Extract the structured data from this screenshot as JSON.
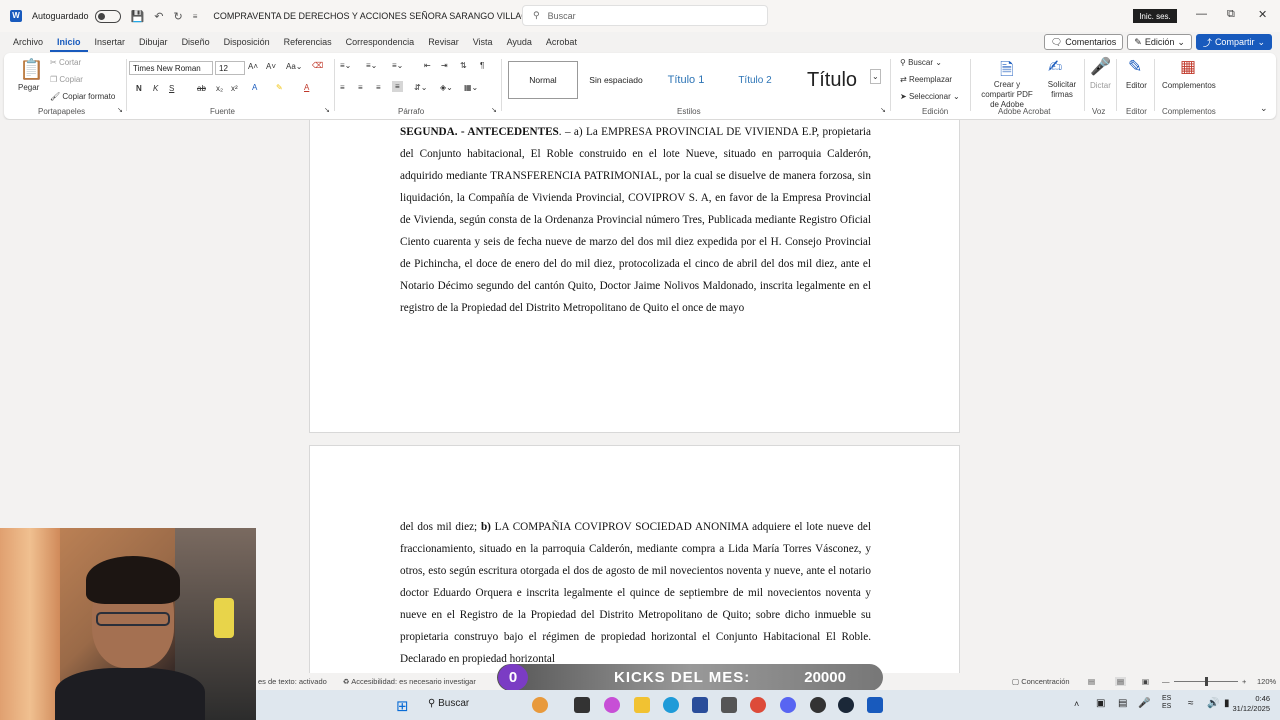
{
  "titlebar": {
    "autosave_label": "Autoguardado",
    "doc_title": "COMPRAVENTA DE DERECHOS Y ACCIONES SEÑORA SARANGO VILLACIS",
    "search_placeholder": "Buscar",
    "signin_label": "Inic. ses."
  },
  "tabs": [
    "Archivo",
    "Inicio",
    "Insertar",
    "Dibujar",
    "Diseño",
    "Disposición",
    "Referencias",
    "Correspondencia",
    "Revisar",
    "Vista",
    "Ayuda",
    "Acrobat"
  ],
  "tab_actions": {
    "comments": "Comentarios",
    "editing": "Edición",
    "share": "Compartir"
  },
  "ribbon": {
    "clipboard": {
      "paste": "Pegar",
      "cut": "Cortar",
      "copy": "Copiar",
      "format_painter": "Copiar formato",
      "label": "Portapapeles"
    },
    "font": {
      "name": "Times New Roman",
      "size": "12",
      "label": "Fuente"
    },
    "paragraph": {
      "label": "Párrafo"
    },
    "styles": {
      "items": [
        "Normal",
        "Sin espaciado",
        "Título 1",
        "Título 2",
        "Título"
      ],
      "label": "Estilos"
    },
    "editing": {
      "find": "Buscar",
      "replace": "Reemplazar",
      "select": "Seleccionar",
      "label": "Edición"
    },
    "adobe": {
      "create_pdf": "Crear y compartir PDF de Adobe",
      "request_sign": "Solicitar firmas",
      "label": "Adobe Acrobat"
    },
    "voice": {
      "dictate": "Dictar",
      "label": "Voz"
    },
    "editor": {
      "name": "Editor",
      "label": "Editor"
    },
    "addins": {
      "name": "Complementos",
      "label": "Complementos"
    }
  },
  "document": {
    "page1": {
      "heading": "SEGUNDA. - ANTECEDENTES",
      "paragraph": ". – a) La EMPRESA PROVINCIAL DE VIVIENDA E.P, propietaria del Conjunto habitacional, El Roble construido en el lote Nueve, situado en parroquia Calderón, adquirido mediante TRANSFERENCIA PATRIMONIAL, por la cual se disuelve de manera forzosa, sin liquidación, la Compañía de Vivienda Provincial, COVIPROV S. A, en favor de la Empresa Provincial de Vivienda, según consta de la Ordenanza Provincial número Tres, Publicada mediante Registro Oficial Ciento cuarenta y seis de fecha nueve de marzo del dos mil diez expedida por el H. Consejo Provincial de Pichincha, el doce de enero del do mil diez, protocolizada el cinco de abril del dos mil diez, ante el Notario Décimo segundo del cantón Quito, Doctor Jaime Nolivos Maldonado, inscrita legalmente en el registro de la Propiedad del Distrito Metropolitano de Quito el once de mayo"
    },
    "page2": {
      "lead": "del dos mil diez; ",
      "bold": "b)",
      "paragraph": " LA COMPAÑIA COVIPROV SOCIEDAD ANONIMA adquiere el lote nueve del fraccionamiento, situado en la parroquia Calderón, mediante compra a Lida María Torres Vásconez, y otros, esto según escritura otorgada el dos de agosto de mil novecientos noventa y nueve, ante el notario doctor Eduardo Orquera e inscrita legalmente el quince de septiembre de mil novecientos noventa y nueve en el Registro de la Propiedad del Distrito Metropolitano de Quito; sobre dicho inmueble su propietaria construyo bajo el régimen de propiedad horizontal el Conjunto Habitacional El Roble. Declarado en propiedad horizontal"
    }
  },
  "statusbar": {
    "left": "es de texto: activado",
    "accessibility": "Accesibilidad: es necesario investigar",
    "focus": "Concentración",
    "zoom": "120%"
  },
  "overlay": {
    "kicks_count": "0",
    "kicks_label": "KICKS DEL MES:",
    "kicks_goal": "20000"
  },
  "taskbar": {
    "search": "Buscar",
    "lang": "ES",
    "region": "ES",
    "time": "0:46",
    "date": "31/12/2025"
  }
}
